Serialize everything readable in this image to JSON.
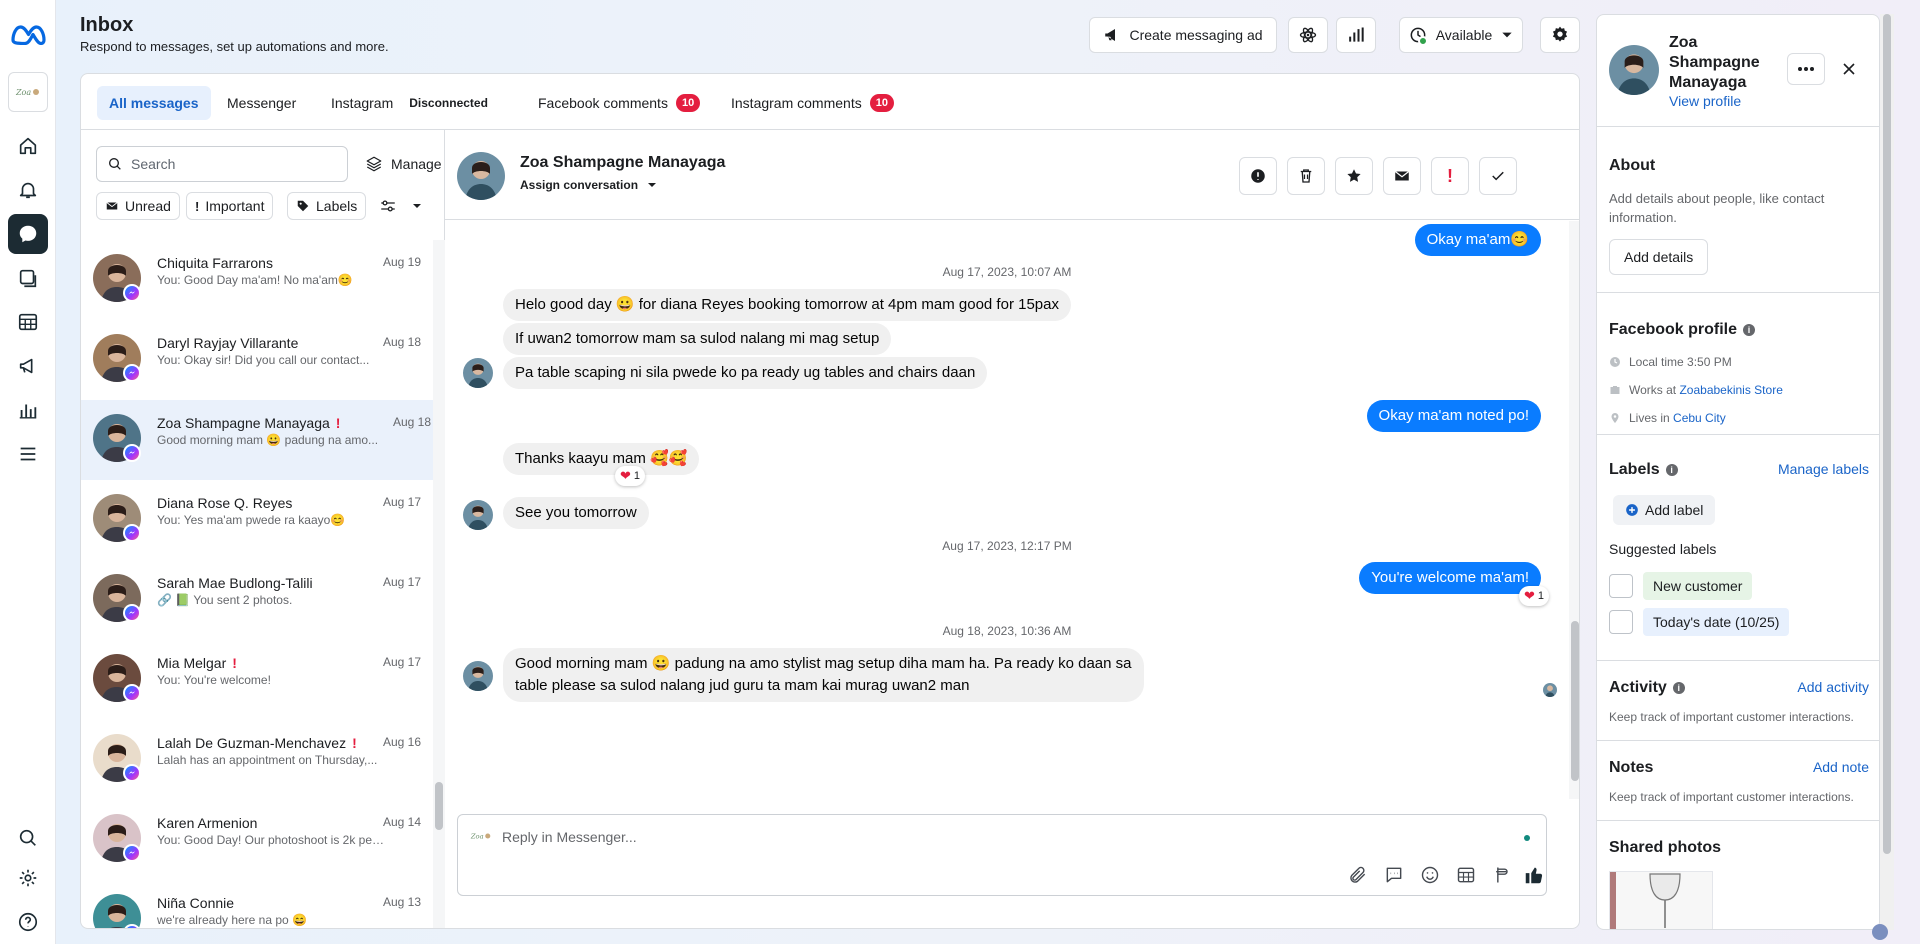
{
  "app": {
    "logo": "meta-logo"
  },
  "header": {
    "title": "Inbox",
    "subtitle": "Respond to messages, set up automations and more.",
    "create_ad": "Create messaging ad",
    "availability": "Available"
  },
  "tabs": [
    {
      "label": "All messages"
    },
    {
      "label": "Messenger"
    },
    {
      "label": "Instagram",
      "status": "Disconnected"
    },
    {
      "label": "Facebook comments",
      "badge": "10"
    },
    {
      "label": "Instagram comments",
      "badge": "10"
    }
  ],
  "list": {
    "search_placeholder": "Search",
    "manage": "Manage",
    "filters": {
      "unread": "Unread",
      "important": "Important",
      "labels": "Labels"
    },
    "conversations": [
      {
        "name": "Chiquita Farrarons",
        "preview": "You: Good Day ma'am! No ma'am😊",
        "date": "Aug 19",
        "important": false,
        "color": "#8a6d5a"
      },
      {
        "name": "Daryl Rayjay Villarante",
        "preview": "You: Okay sir! Did you call our contact...",
        "date": "Aug 18",
        "important": false,
        "color": "#a07d5c"
      },
      {
        "name": "Zoa Shampagne Manayaga",
        "preview": "Good morning mam 😀 padung na amo...",
        "date": "Aug 18",
        "important": true,
        "color": "#4f7488"
      },
      {
        "name": "Diana Rose Q. Reyes",
        "preview": "You: Yes ma'am pwede ra kaayo😊",
        "date": "Aug 17",
        "important": false,
        "color": "#9e8c78"
      },
      {
        "name": "Sarah Mae Budlong-Talili",
        "preview": "🔗 📗 You sent 2 photos.",
        "date": "Aug 17",
        "important": false,
        "color": "#7c6a5c"
      },
      {
        "name": "Mia Melgar",
        "preview": "You: You're welcome!",
        "date": "Aug 17",
        "important": true,
        "color": "#6b4b3e"
      },
      {
        "name": "Lalah De Guzman-Menchavez",
        "preview": "Lalah has an appointment on Thursday,...",
        "date": "Aug 16",
        "important": true,
        "color": "#e9dccb"
      },
      {
        "name": "Karen Armenion",
        "preview": "You: Good Day! Our photoshoot is 2k pes...",
        "date": "Aug 14",
        "important": false,
        "color": "#d9c3c8"
      },
      {
        "name": "Niña Connie",
        "preview": "we're already here na po 😄",
        "date": "Aug 13",
        "important": false,
        "color": "#3e8f96"
      }
    ]
  },
  "thread": {
    "name": "Zoa Shampagne Manayaga",
    "assign": "Assign conversation",
    "messages": [
      {
        "type": "out",
        "text": "Okay ma'am😊"
      },
      {
        "type": "stamp",
        "text": "Aug 17, 2023, 10:07 AM"
      },
      {
        "type": "in",
        "text": "Helo good day 😀 for diana Reyes booking tomorrow at 4pm mam good for 15pax"
      },
      {
        "type": "in",
        "text": "If uwan2 tomorrow mam sa sulod nalang mi mag setup"
      },
      {
        "type": "in",
        "text": "Pa table scaping ni sila pwede ko pa ready ug tables and chairs daan"
      },
      {
        "type": "out",
        "text": "Okay ma'am noted po!"
      },
      {
        "type": "in",
        "text": "Thanks kaayu mam 🥰🥰",
        "reaction": "1"
      },
      {
        "type": "in",
        "text": "See you tomorrow"
      },
      {
        "type": "stamp",
        "text": "Aug 17, 2023, 12:17 PM"
      },
      {
        "type": "out",
        "text": "You're welcome ma'am!",
        "reaction": "1"
      },
      {
        "type": "stamp",
        "text": "Aug 18, 2023, 10:36 AM"
      },
      {
        "type": "in",
        "line1": "Good morning mam 😀 padung na amo stylist mag setup diha mam ha. Pa ready ko daan sa",
        "line2": "table please sa sulod nalang jud guru ta mam kai murag uwan2 man"
      }
    ],
    "reply_placeholder": "Reply in Messenger..."
  },
  "profile": {
    "name_line1": "Zoa",
    "name_line2": "Shampagne",
    "name_line3": "Manayaga",
    "view_profile": "View profile",
    "about": {
      "title": "About",
      "desc": "Add details about people, like contact information.",
      "button": "Add details"
    },
    "facebook": {
      "title": "Facebook profile",
      "local_time": "Local time 3:50 PM",
      "works_prefix": "Works at",
      "works": "Zoababekinis Store",
      "lives_prefix": "Lives in",
      "lives": "Cebu City"
    },
    "labels": {
      "title": "Labels",
      "manage": "Manage labels",
      "add": "Add label",
      "suggested": "Suggested labels",
      "items": [
        {
          "text": "New customer",
          "color": "#e6f4e6"
        },
        {
          "text": "Today's date (10/25)",
          "color": "#e7f0fd"
        }
      ]
    },
    "activity": {
      "title": "Activity",
      "link": "Add activity",
      "desc": "Keep track of important customer interactions."
    },
    "notes": {
      "title": "Notes",
      "link": "Add note",
      "desc": "Keep track of important customer interactions."
    },
    "photos": {
      "title": "Shared photos"
    }
  }
}
